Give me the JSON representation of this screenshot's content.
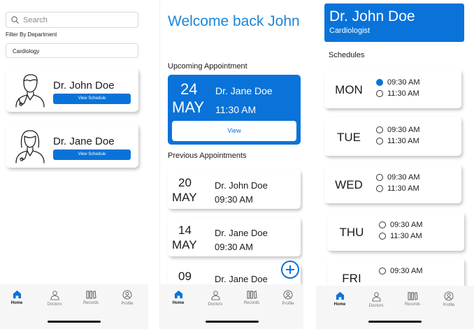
{
  "doctors_screen": {
    "search_placeholder": "Search",
    "filter_label": "Filter By Department",
    "department": "Cardiology",
    "doctors": [
      {
        "name": "Dr. John Doe",
        "button": "View Schedule"
      },
      {
        "name": "Dr. Jane Doe",
        "button": "View Schedule"
      }
    ]
  },
  "home_screen": {
    "welcome": "Welcome back John",
    "upcoming_title": "Upcoming Appointment",
    "upcoming": {
      "day": "24",
      "month": "MAY",
      "doctor": "Dr. Jane Doe",
      "time": "11:30 AM",
      "button": "View"
    },
    "previous_title": "Previous Appointments",
    "previous": [
      {
        "day": "20",
        "month": "MAY",
        "doctor": "Dr. John Doe",
        "time": "09:30 AM"
      },
      {
        "day": "14",
        "month": "MAY",
        "doctor": "Dr. Jane Doe",
        "time": "09:30 AM"
      },
      {
        "day": "09",
        "month": "",
        "doctor": "Dr. Jane Doe",
        "time": ""
      }
    ]
  },
  "schedule_screen": {
    "doctor_name": "Dr. John Doe",
    "specialty": "Cardiologist",
    "schedules_title": "Schedules",
    "days": [
      {
        "day": "MON",
        "slots": [
          "09:30 AM",
          "11:30 AM"
        ],
        "selected": 0
      },
      {
        "day": "TUE",
        "slots": [
          "09:30 AM",
          "11:30 AM"
        ],
        "selected": -1
      },
      {
        "day": "WED",
        "slots": [
          "09:30 AM",
          "11:30 AM"
        ],
        "selected": -1
      },
      {
        "day": "THU",
        "slots": [
          "09:30 AM",
          "11:30 AM"
        ],
        "selected": -1
      },
      {
        "day": "FRI",
        "slots": [
          "09:30 AM"
        ],
        "selected": -1
      }
    ]
  },
  "nav": {
    "home": "Home",
    "doctors": "Doctors",
    "records": "Records",
    "profile": "Profile"
  },
  "colors": {
    "primary": "#0a73d9",
    "heading": "#1a86d9",
    "nav_bg": "#f6f6f6"
  }
}
